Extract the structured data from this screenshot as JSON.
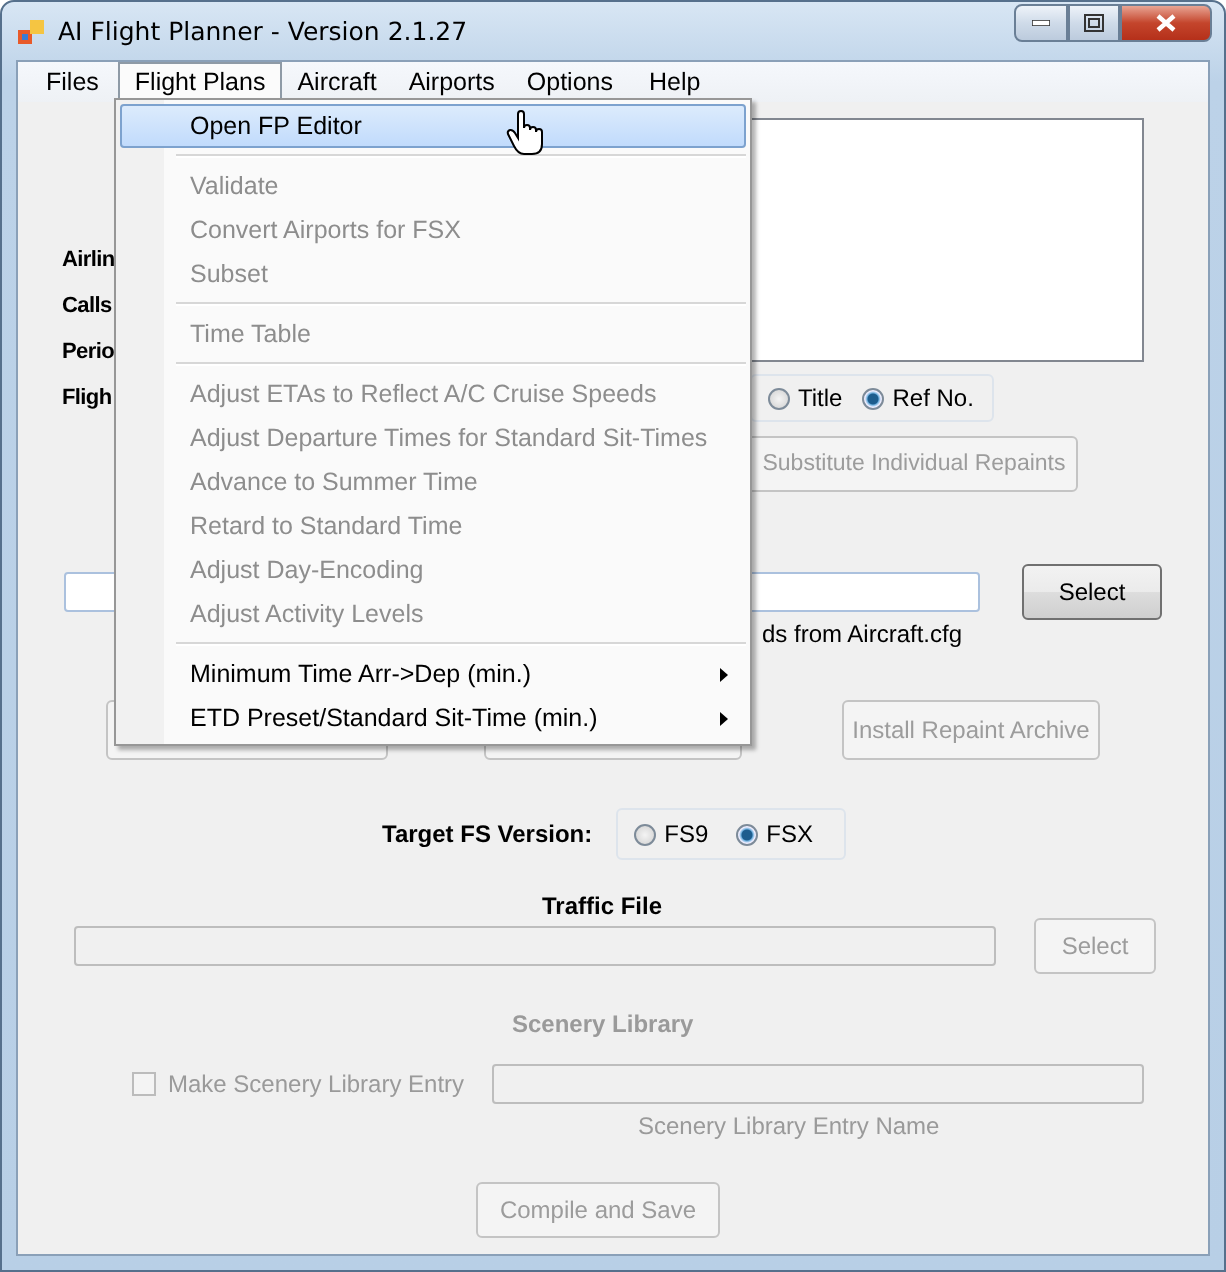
{
  "window": {
    "title": "AI Flight Planner - Version 2.1.27"
  },
  "menu_bar": [
    {
      "label": "Files",
      "selected": false
    },
    {
      "label": "Flight Plans",
      "selected": true
    },
    {
      "label": "Aircraft",
      "selected": false
    },
    {
      "label": "Airports",
      "selected": false
    },
    {
      "label": "Options",
      "selected": false
    },
    {
      "label": "Help",
      "selected": false
    }
  ],
  "dropdown": {
    "items": [
      {
        "kind": "item",
        "label": "Open FP Editor",
        "highlighted": true,
        "disabled": false
      },
      {
        "kind": "separator"
      },
      {
        "kind": "item",
        "label": "Validate",
        "highlighted": false,
        "disabled": true
      },
      {
        "kind": "item",
        "label": "Convert Airports for FSX",
        "highlighted": false,
        "disabled": true
      },
      {
        "kind": "item",
        "label": "Subset",
        "highlighted": false,
        "disabled": true
      },
      {
        "kind": "separator"
      },
      {
        "kind": "item",
        "label": "Time Table",
        "highlighted": false,
        "disabled": true
      },
      {
        "kind": "separator"
      },
      {
        "kind": "item",
        "label": "Adjust ETAs to Reflect A/C Cruise Speeds",
        "highlighted": false,
        "disabled": true
      },
      {
        "kind": "item",
        "label": "Adjust Departure Times for Standard Sit-Times",
        "highlighted": false,
        "disabled": true
      },
      {
        "kind": "item",
        "label": "Advance to Summer Time",
        "highlighted": false,
        "disabled": true
      },
      {
        "kind": "item",
        "label": "Retard to Standard Time",
        "highlighted": false,
        "disabled": true
      },
      {
        "kind": "item",
        "label": "Adjust Day-Encoding",
        "highlighted": false,
        "disabled": true
      },
      {
        "kind": "item",
        "label": "Adjust Activity Levels",
        "highlighted": false,
        "disabled": true
      },
      {
        "kind": "separator"
      },
      {
        "kind": "submenu",
        "label": "Minimum Time Arr->Dep (min.)",
        "highlighted": false,
        "disabled": false
      },
      {
        "kind": "submenu",
        "label": "ETD Preset/Standard Sit-Time (min.)",
        "highlighted": false,
        "disabled": false
      }
    ]
  },
  "form": {
    "labels": [
      "Airlin",
      "Calls",
      "Perio",
      "Fligh"
    ],
    "sort_options": [
      {
        "label": "Title",
        "selected": false
      },
      {
        "label": "Ref No.",
        "selected": true
      }
    ],
    "substitute_button": {
      "label": "Substitute Individual Repaints",
      "disabled": true
    },
    "select_button": {
      "label": "Select",
      "disabled": false
    },
    "aircraft_note": "ds from Aircraft.cfg",
    "livery_buttons": [
      {
        "disabled": true
      },
      {
        "disabled": true
      },
      {
        "label": "Install Repaint Archive",
        "disabled": true
      }
    ],
    "target_fs": {
      "label": "Target FS Version:",
      "options": [
        {
          "label": "FS9",
          "selected": false
        },
        {
          "label": "FSX",
          "selected": true
        }
      ]
    },
    "traffic_file": {
      "title": "Traffic File",
      "select_button": {
        "label": "Select",
        "disabled": true
      }
    },
    "scenery_library": {
      "title": "Scenery Library",
      "disabled": true,
      "checkbox": {
        "label": "Make Scenery Library Entry",
        "checked": false
      },
      "entry_caption": "Scenery Library Entry Name"
    },
    "compile_button": {
      "label": "Compile and Save",
      "disabled": true
    }
  }
}
